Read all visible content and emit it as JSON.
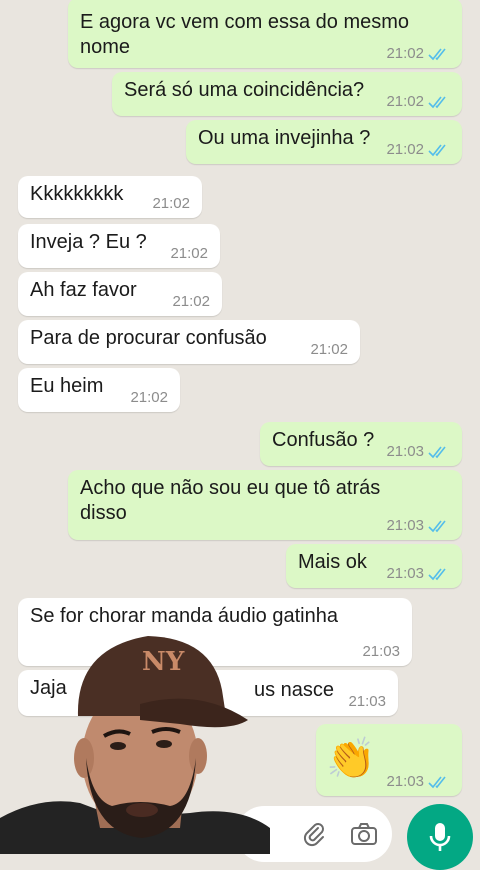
{
  "conversation": {
    "messages": [
      {
        "dir": "out",
        "text": "E agora vc vem com essa do mesmo\nnome",
        "time": "21:02",
        "read": true
      },
      {
        "dir": "out",
        "text": "Será só uma coincidência?",
        "time": "21:02",
        "read": true
      },
      {
        "dir": "out",
        "text": "Ou uma invejinha ?",
        "time": "21:02",
        "read": true
      },
      {
        "dir": "in",
        "text": "Kkkkkkkkk",
        "time": "21:02"
      },
      {
        "dir": "in",
        "text": "Inveja ? Eu ?",
        "time": "21:02"
      },
      {
        "dir": "in",
        "text": "Ah faz favor",
        "time": "21:02"
      },
      {
        "dir": "in",
        "text": "Para de procurar confusão",
        "time": "21:02"
      },
      {
        "dir": "in",
        "text": "Eu heim",
        "time": "21:02"
      },
      {
        "dir": "out",
        "text": "Confusão ?",
        "time": "21:03",
        "read": true
      },
      {
        "dir": "out",
        "text": "Acho que não sou eu que tô atrás\ndisso",
        "time": "21:03",
        "read": true
      },
      {
        "dir": "out",
        "text": "Mais ok",
        "time": "21:03",
        "read": true
      },
      {
        "dir": "in",
        "text": "Se for chorar manda áudio gatinha",
        "time": "21:03"
      },
      {
        "dir": "in",
        "text": "Jaja",
        "text_tail": "us nasce",
        "time": "21:03"
      },
      {
        "dir": "out",
        "emoji": "👏",
        "time": "21:03",
        "read": true
      }
    ]
  },
  "composer": {
    "attach_icon": "paperclip-icon",
    "camera_icon": "camera-icon",
    "mic_icon": "microphone-icon"
  },
  "colors": {
    "background": "#e9e5df",
    "outgoing_bubble": "#dcf8c6",
    "incoming_bubble": "#ffffff",
    "read_ticks": "#53bdeb",
    "mic_button": "#03a884"
  },
  "overlay": {
    "webcam_person": "man-with-brown-ny-cap"
  }
}
